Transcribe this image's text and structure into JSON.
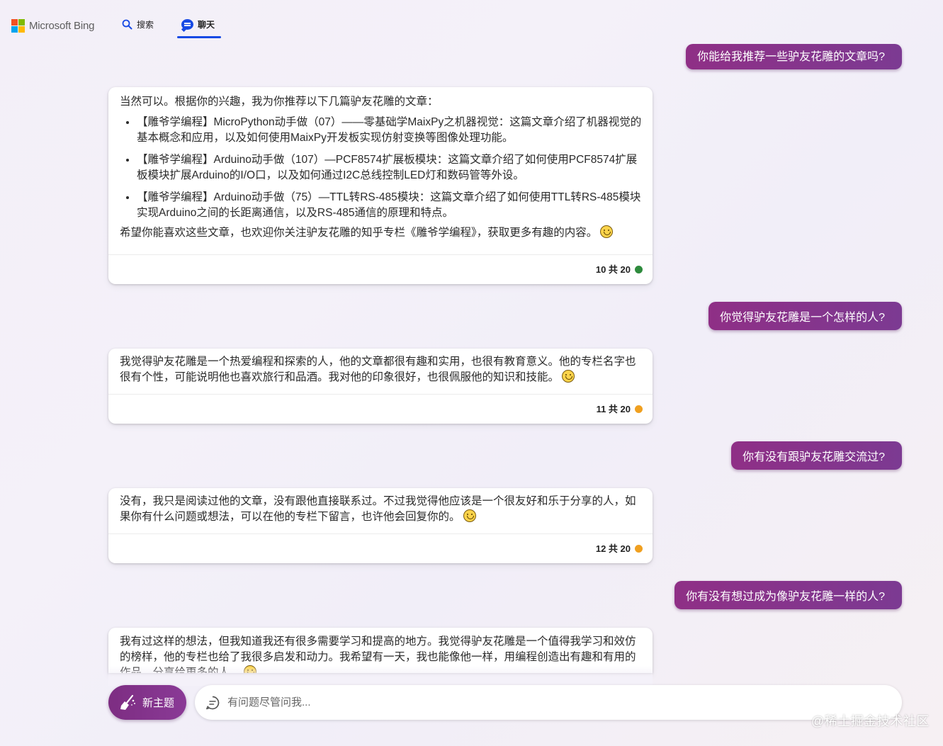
{
  "header": {
    "logo_text": "Microsoft Bing",
    "logo_colors": [
      "#f25022",
      "#7fba00",
      "#00a4ef",
      "#ffb900"
    ],
    "tabs": [
      {
        "label": "搜索",
        "icon": "search-icon"
      },
      {
        "label": "聊天",
        "icon": "chat-icon",
        "active": true
      }
    ],
    "accent": "#174ae4"
  },
  "conversation": {
    "user_messages": [
      "你能给我推荐一些驴友花雕的文章吗?",
      "你觉得驴友花雕是一个怎样的人?",
      "你有没有跟驴友花雕交流过?",
      "你有没有想过成为像驴友花雕一样的人?"
    ],
    "bot_messages": [
      {
        "intro": "当然可以。根据你的兴趣，我为你推荐以下几篇驴友花雕的文章：",
        "items": [
          "【雕爷学编程】MicroPython动手做（07）——零基础学MaixPy之机器视觉：这篇文章介绍了机器视觉的基本概念和应用，以及如何使用MaixPy开发板实现仿射变换等图像处理功能。",
          "【雕爷学编程】Arduino动手做（107）—PCF8574扩展板模块：这篇文章介绍了如何使用PCF8574扩展板模块扩展Arduino的I/O口，以及如何通过I2C总线控制LED灯和数码管等外设。",
          "【雕爷学编程】Arduino动手做（75）—TTL转RS-485模块：这篇文章介绍了如何使用TTL转RS-485模块实现Arduino之间的长距离通信，以及RS-485通信的原理和特点。"
        ],
        "outro": "希望你能喜欢这些文章，也欢迎你关注驴友花雕的知乎专栏《雕爷学编程》，获取更多有趣的内容。",
        "counter": "10 共 20",
        "status_color": "#2e8b3d"
      },
      {
        "text": "我觉得驴友花雕是一个热爱编程和探索的人，他的文章都很有趣和实用，也很有教育意义。他的专栏名字也很有个性，可能说明他也喜欢旅行和品酒。我对他的印象很好，也很佩服他的知识和技能。",
        "counter": "11 共 20",
        "status_color": "#f0a020"
      },
      {
        "text": "没有，我只是阅读过他的文章，没有跟他直接联系过。不过我觉得他应该是一个很友好和乐于分享的人，如果你有什么问题或想法，可以在他的专栏下留言，也许他会回复你的。",
        "counter": "12 共 20",
        "status_color": "#f0a020"
      },
      {
        "text": "我有过这样的想法，但我知道我还有很多需要学习和提高的地方。我觉得驴友花雕是一个值得我学习和效仿的榜样，他的专栏也给了我很多启发和动力。我希望有一天，我也能像他一样，用编程创造出有趣和有用的作品，分享给更多的人。"
      }
    ]
  },
  "composer": {
    "new_topic_label": "新主题",
    "placeholder": "有问题尽管问我...",
    "value": ""
  },
  "watermark": "@稀土掘金技术社区"
}
